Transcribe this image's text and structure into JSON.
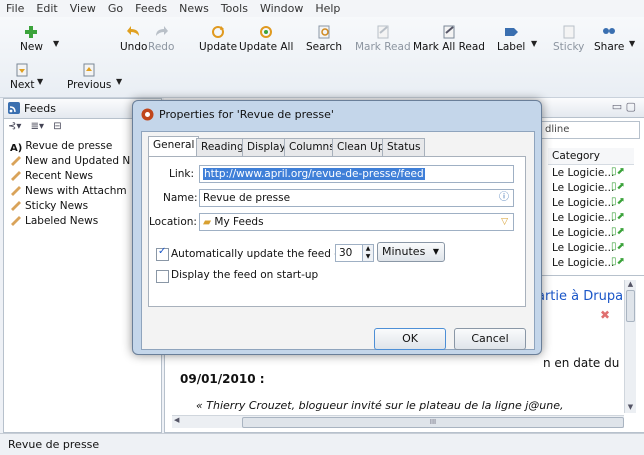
{
  "menu": [
    "File",
    "Edit",
    "View",
    "Go",
    "Feeds",
    "News",
    "Tools",
    "Window",
    "Help"
  ],
  "toolbar": {
    "new": "New",
    "undo": "Undo",
    "redo": "Redo",
    "update": "Update",
    "update_all": "Update All",
    "search": "Search",
    "mark_read": "Mark Read",
    "mark_all_read": "Mark All Read",
    "label": "Label",
    "sticky": "Sticky",
    "share": "Share",
    "next": "Next",
    "previous": "Previous"
  },
  "feeds_panel": {
    "title": "Feeds",
    "items": [
      "Revue de presse",
      "New and Updated N",
      "Recent News",
      "News with Attachm",
      "Sticky News",
      "Labeled News"
    ]
  },
  "news_panel": {
    "search_fragment": "dline",
    "category_header": "Category",
    "categories": [
      "Le Logicie...",
      "Le Logicie...",
      "Le Logicie...",
      "Le Logicie...",
      "Le Logicie...",
      "Le Logicie...",
      "Le Logicie..."
    ],
    "content_heading": "artie à Drupal",
    "content_line1a": "n en date du",
    "content_line1b": "09/01/2010 :",
    "content_quote": "« Thierry Crouzet, blogueur invité sur le plateau de la ligne j@une,",
    "scroll_mark": "III"
  },
  "dialog": {
    "title": "Properties for 'Revue de presse'",
    "tabs": [
      "General",
      "Reading",
      "Display",
      "Columns",
      "Clean Up",
      "Status"
    ],
    "link_label": "Link:",
    "link_value": "http://www.april.org/revue-de-presse/feed",
    "name_label": "Name:",
    "name_value": "Revue de presse",
    "location_label": "Location:",
    "location_value": "My Feeds",
    "auto_update_label": "Automatically update the feed every",
    "auto_update_checked": true,
    "update_interval": "30",
    "update_unit": "Minutes",
    "startup_label": "Display the feed on start-up",
    "startup_checked": false,
    "ok": "OK",
    "cancel": "Cancel"
  },
  "status_text": "Revue de presse",
  "colors": {
    "accent": "#1a56c8",
    "selection": "#3f7fd8"
  }
}
